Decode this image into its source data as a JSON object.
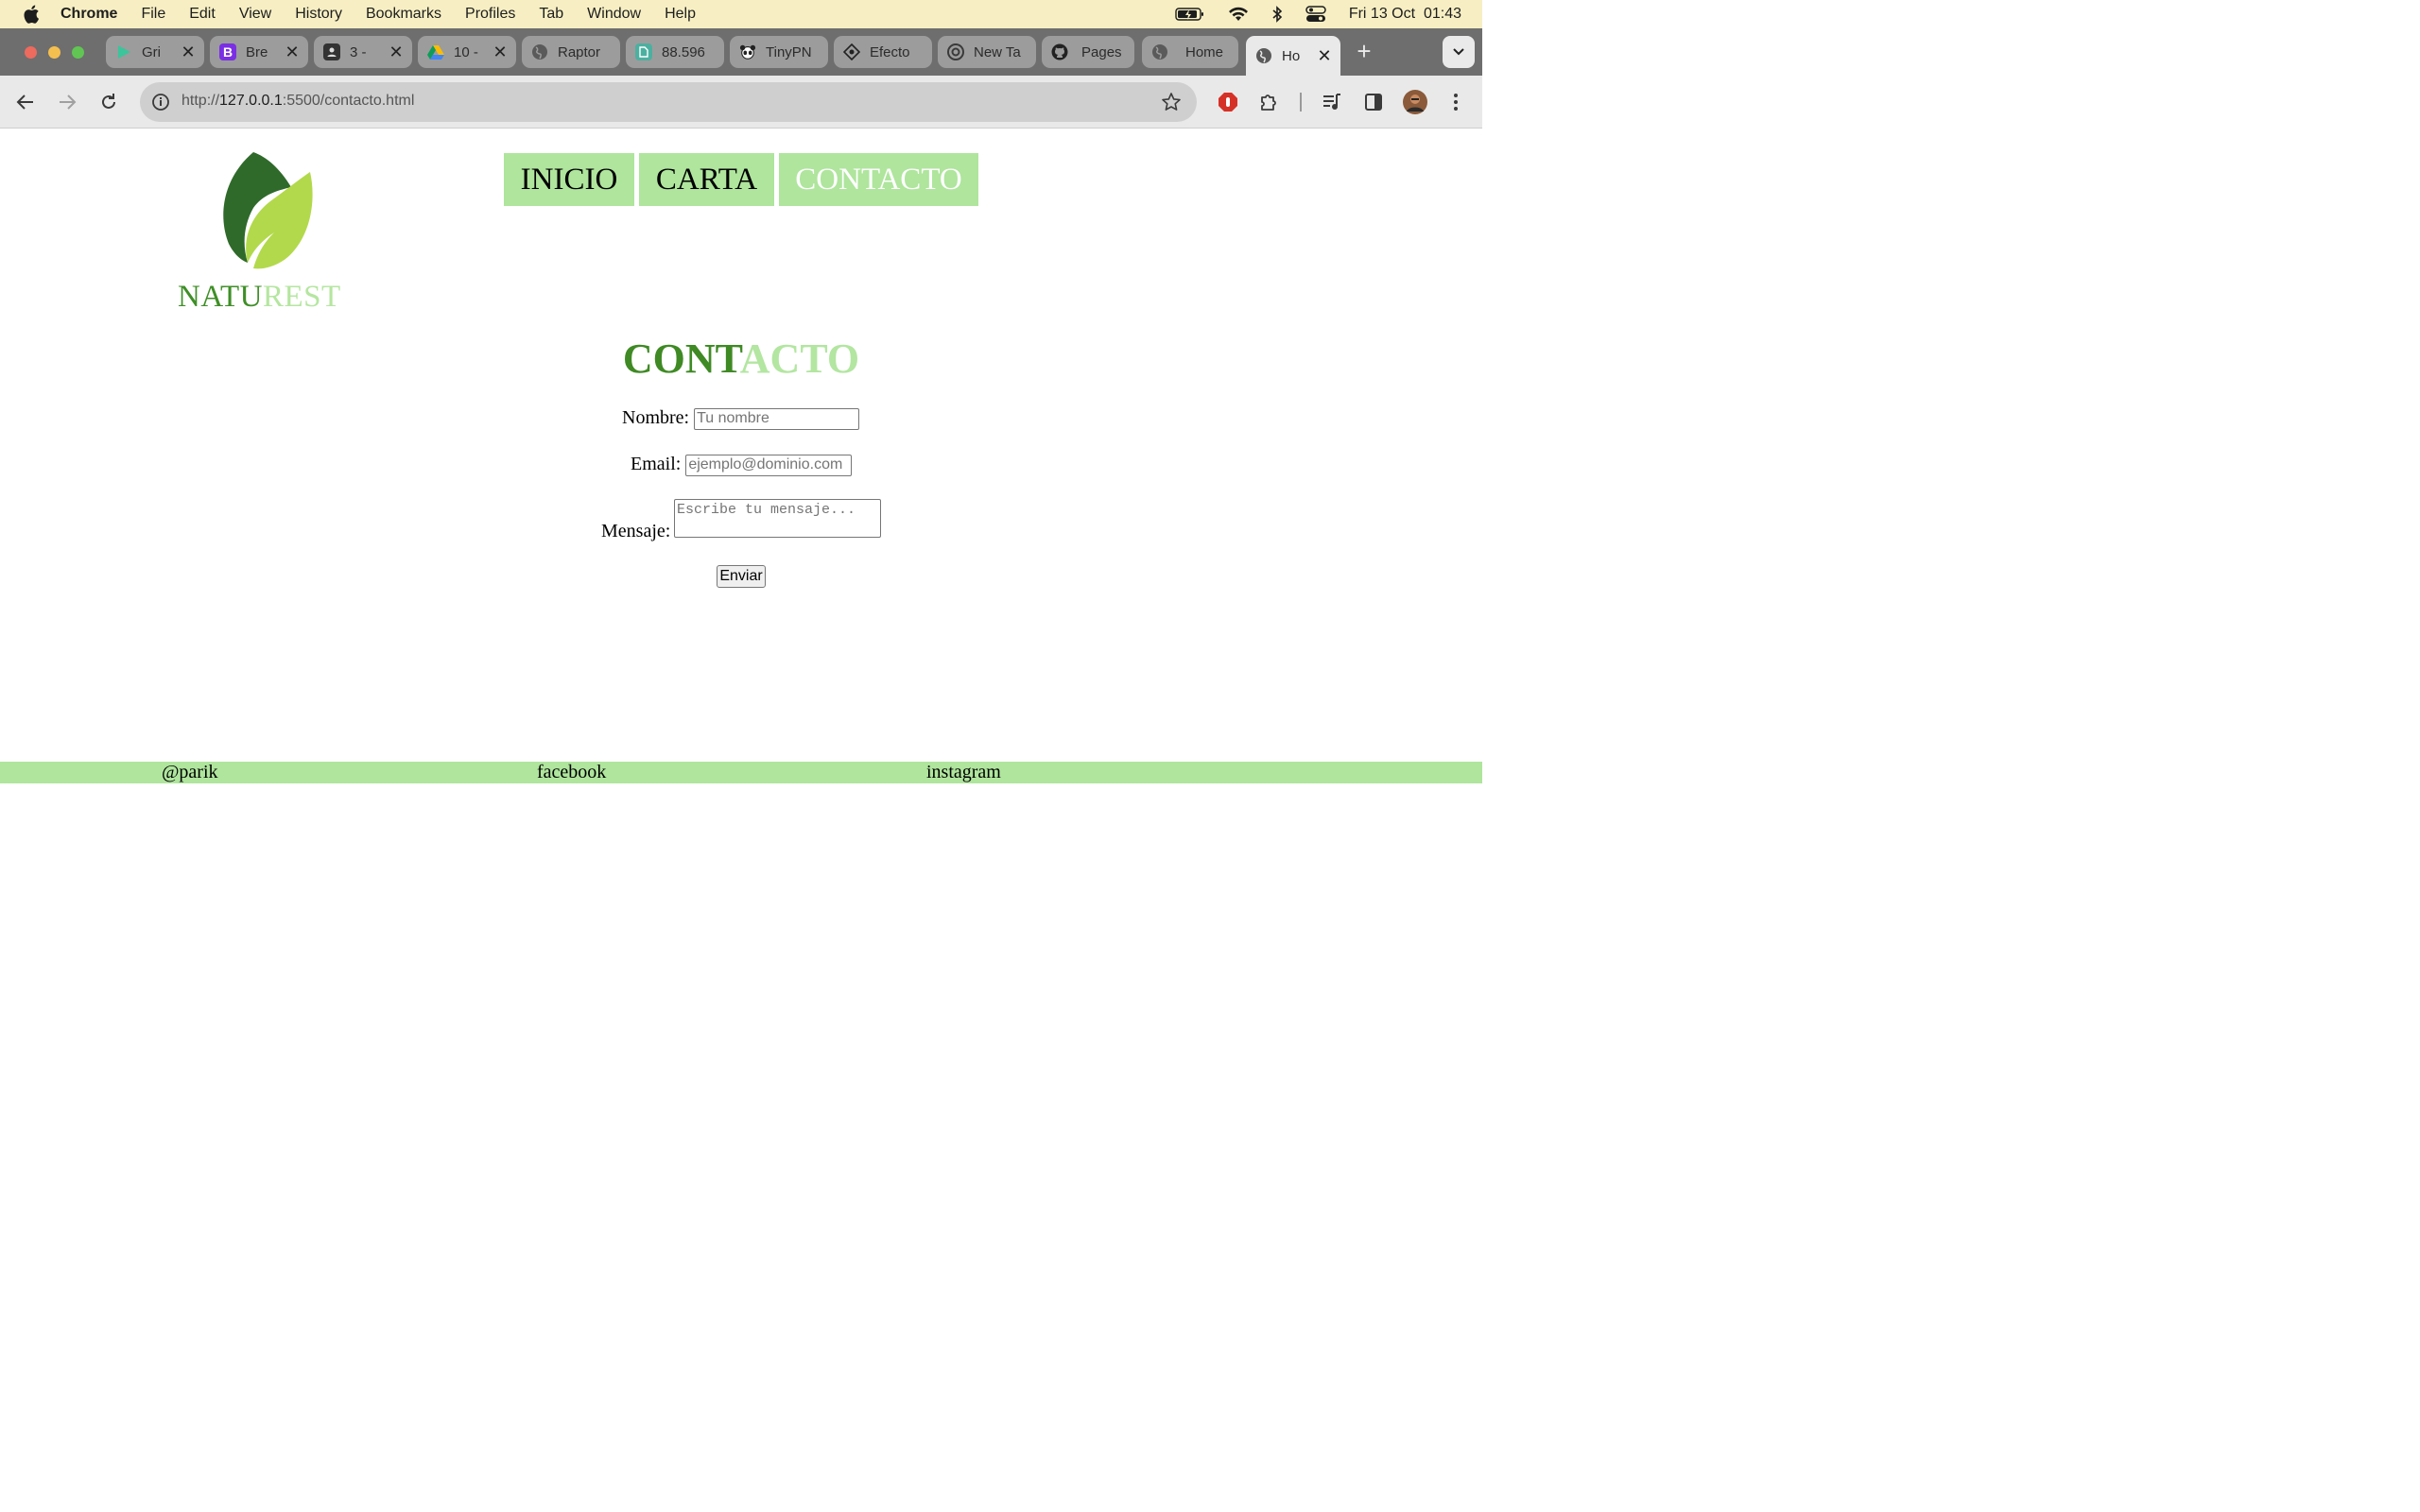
{
  "menubar": {
    "app": "Chrome",
    "items": [
      "File",
      "Edit",
      "View",
      "History",
      "Bookmarks",
      "Profiles",
      "Tab",
      "Window",
      "Help"
    ],
    "clock": "Fri 13 Oct  01:43",
    "icons": [
      "apple-icon",
      "battery-icon",
      "wifi-icon",
      "bluetooth-icon",
      "control-center-icon"
    ]
  },
  "tabs": [
    {
      "title": "Gri",
      "icon": "play-icon"
    },
    {
      "title": "Bre",
      "icon": "bootstrap-icon"
    },
    {
      "title": "3 -",
      "icon": "contact-icon"
    },
    {
      "title": "10 -",
      "icon": "drive-icon"
    },
    {
      "title": "Raptor",
      "icon": "globe-icon"
    },
    {
      "title": "88.596",
      "icon": "page-icon"
    },
    {
      "title": "TinyPN",
      "icon": "panda-icon"
    },
    {
      "title": "Efecto",
      "icon": "diamond-icon"
    },
    {
      "title": "New Ta",
      "icon": "chrome-icon"
    },
    {
      "title": "Pages",
      "icon": "github-icon"
    },
    {
      "title": "Home",
      "icon": "globe-icon"
    },
    {
      "title": "Ho",
      "icon": "globe-icon",
      "active": true
    }
  ],
  "address": {
    "prefix": "http://",
    "host": "127.0.0.1",
    "rest": ":5500/contacto.html"
  },
  "site": {
    "brand_a": "NATU",
    "brand_b": "REST",
    "nav": [
      "INICIO",
      "CARTA",
      "CONTACTO"
    ],
    "current_nav": "CONTACTO",
    "heading_a": "CONT",
    "heading_b": "ACTO",
    "form": {
      "name_label": "Nombre:",
      "name_placeholder": "Tu nombre",
      "email_label": "Email:",
      "email_placeholder": "ejemplo@dominio.com",
      "message_label": "Mensaje:",
      "message_placeholder": "Escribe tu mensaje...",
      "submit": "Enviar"
    },
    "footer": [
      "@parik",
      "facebook",
      "instagram"
    ]
  },
  "colors": {
    "menubar_bg": "#f7efc3",
    "tabstrip_bg": "#6e6e6e",
    "nav_bg": "#afe59d",
    "brand_dark": "#3f8f27",
    "brand_light": "#b5e6a0",
    "leaf_dark": "#2f6a2a",
    "leaf_light": "#b2d94b"
  }
}
